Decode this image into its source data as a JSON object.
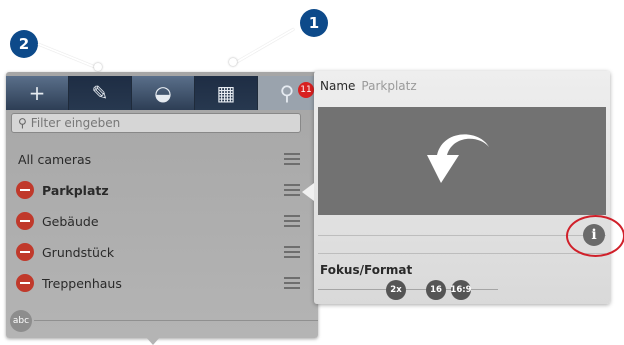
{
  "callouts": [
    "1",
    "2"
  ],
  "toolbar": {
    "buttons": [
      {
        "icon": "plus-icon",
        "glyph": "+"
      },
      {
        "icon": "edit-icon",
        "glyph": "✎"
      },
      {
        "icon": "camera-icon",
        "glyph": "◒"
      },
      {
        "icon": "grid-icon",
        "glyph": "▦"
      },
      {
        "icon": "search-icon",
        "glyph": "⚲"
      }
    ],
    "search_count": "11"
  },
  "filter": {
    "placeholder": "Filter eingeben"
  },
  "list": {
    "header": "All cameras",
    "items": [
      {
        "label": "Parkplatz",
        "selected": true
      },
      {
        "label": "Gebäude",
        "selected": false
      },
      {
        "label": "Grundstück",
        "selected": false
      },
      {
        "label": "Treppenhaus",
        "selected": false
      }
    ],
    "abc_badge": "abc"
  },
  "detail": {
    "name_label": "Name",
    "name_value": "Parkplatz",
    "info_glyph": "i",
    "fokus_label": "Fokus/Format",
    "format_buttons": [
      "2x",
      "16",
      "16:9"
    ]
  },
  "colors": {
    "accent_blue": "#0d4a8a",
    "remove_red": "#c0392b",
    "highlight_ring": "#d0202a"
  }
}
